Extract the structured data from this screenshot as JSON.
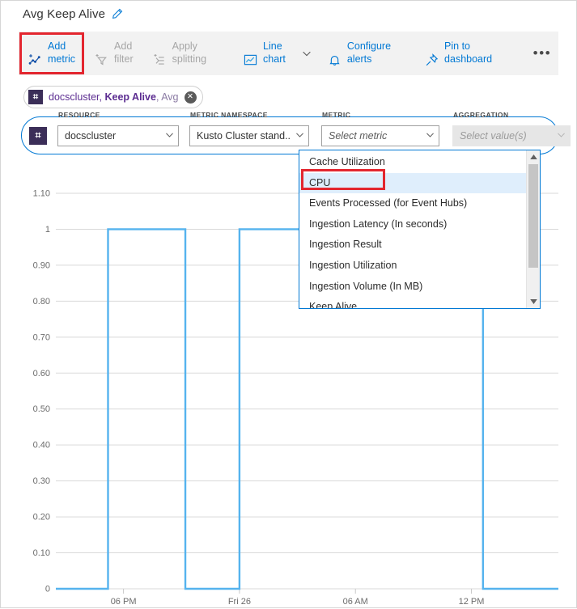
{
  "header": {
    "title": "Avg Keep Alive",
    "edit_icon": "pencil-icon"
  },
  "toolbar": {
    "items": [
      {
        "label": "Add\nmetric",
        "icon": "add-metric-icon",
        "disabled": false,
        "highlighted": true
      },
      {
        "label": "Add\nfilter",
        "icon": "add-filter-icon",
        "disabled": true,
        "highlighted": false
      },
      {
        "label": "Apply\nsplitting",
        "icon": "apply-splitting-icon",
        "disabled": true,
        "highlighted": false
      },
      {
        "label": "Line\nchart",
        "icon": "line-chart-icon",
        "disabled": false,
        "highlighted": false
      },
      {
        "label": "Configure\nalerts",
        "icon": "bell-icon",
        "disabled": false,
        "highlighted": false
      },
      {
        "label": "Pin to\ndashboard",
        "icon": "pin-icon",
        "disabled": false,
        "highlighted": false
      }
    ],
    "chart_type_caret": "chevron-down-icon",
    "overflow": "•••"
  },
  "chip": {
    "badge": "⌗",
    "resource": "docscluster, ",
    "metric": "Keep Alive",
    "aggregation": ", Avg",
    "close": "✕"
  },
  "selector": {
    "badge": "⌗",
    "fields": [
      {
        "label": "RESOURCE",
        "value": "docscluster",
        "placeholder": "",
        "disabled": false
      },
      {
        "label": "METRIC NAMESPACE",
        "value": "Kusto Cluster stand...",
        "placeholder": "",
        "disabled": false
      },
      {
        "label": "METRIC",
        "value": "Select metric",
        "placeholder": "Select metric",
        "disabled": false
      },
      {
        "label": "AGGREGATION",
        "value": "Select value(s)",
        "placeholder": "Select value(s)",
        "disabled": true
      }
    ],
    "close": "✕"
  },
  "dropdown": {
    "items": [
      {
        "label": "Cache Utilization",
        "selected": false
      },
      {
        "label": "CPU",
        "selected": true
      },
      {
        "label": "Events Processed (for Event Hubs)",
        "selected": false
      },
      {
        "label": "Ingestion Latency (In seconds)",
        "selected": false
      },
      {
        "label": "Ingestion Result",
        "selected": false
      },
      {
        "label": "Ingestion Utilization",
        "selected": false
      },
      {
        "label": "Ingestion Volume (In MB)",
        "selected": false
      },
      {
        "label": "Keep Alive",
        "selected": false
      }
    ],
    "scroll_up_icon": "scroll-up-arrow-icon",
    "scroll_down_icon": "scroll-down-arrow-icon"
  },
  "colors": {
    "accent": "#0078d4",
    "series": "#55b3ee",
    "highlight": "#e3262f",
    "chip_text": "#5c2d91",
    "grid": "#d9d9d9"
  },
  "chart_data": {
    "type": "line",
    "title": "Avg Keep Alive",
    "xlabel": "",
    "ylabel": "",
    "grid": true,
    "legend": false,
    "series_name": "Keep Alive (Avg)",
    "series_color": "#55b3ee",
    "ytick_labels": [
      "1.10",
      "1",
      "0.90",
      "0.80",
      "0.70",
      "0.60",
      "0.50",
      "0.40",
      "0.30",
      "0.20",
      "0.10",
      "0"
    ],
    "yticks": [
      1.1,
      1,
      0.9,
      0.8,
      0.7,
      0.6,
      0.5,
      0.4,
      0.3,
      0.2,
      0.1,
      0
    ],
    "ylim": [
      0,
      1.1
    ],
    "xtick_labels": [
      "06 PM",
      "Fri 26",
      "06 AM",
      "12 PM"
    ],
    "xticks": [
      18,
      24,
      30,
      36
    ],
    "xlim": [
      14.5,
      40.5
    ],
    "x": [
      14.5,
      17.2,
      17.2,
      21.2,
      21.2,
      24.0,
      24.0,
      36.6,
      36.6,
      40.5
    ],
    "y": [
      0,
      0,
      1,
      1,
      0,
      0,
      1,
      1,
      0,
      0
    ],
    "description": "Square-wave step series alternating between 0 and 1"
  }
}
